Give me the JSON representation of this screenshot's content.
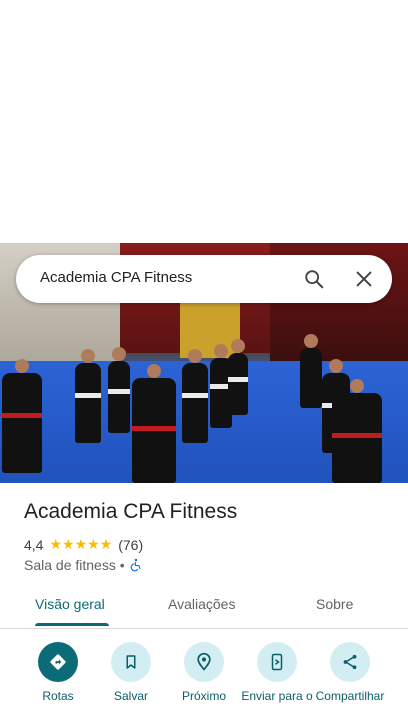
{
  "search": {
    "query": "Academia CPA Fitness"
  },
  "place": {
    "title": "Academia CPA Fitness",
    "rating": "4,4",
    "stars": "★★★★★",
    "review_count": "(76)",
    "category": "Sala de fitness •"
  },
  "tabs": [
    {
      "label": "Visão geral",
      "active": true
    },
    {
      "label": "Avaliações",
      "active": false
    },
    {
      "label": "Sobre",
      "active": false
    }
  ],
  "actions": {
    "route": "Rotas",
    "save": "Salvar",
    "nearby": "Próximo",
    "send": "Enviar para o",
    "share": "Compartilhar"
  },
  "colors": {
    "accent": "#0b6b77",
    "star": "#fbbc04",
    "action_bg": "#d3eef3"
  }
}
